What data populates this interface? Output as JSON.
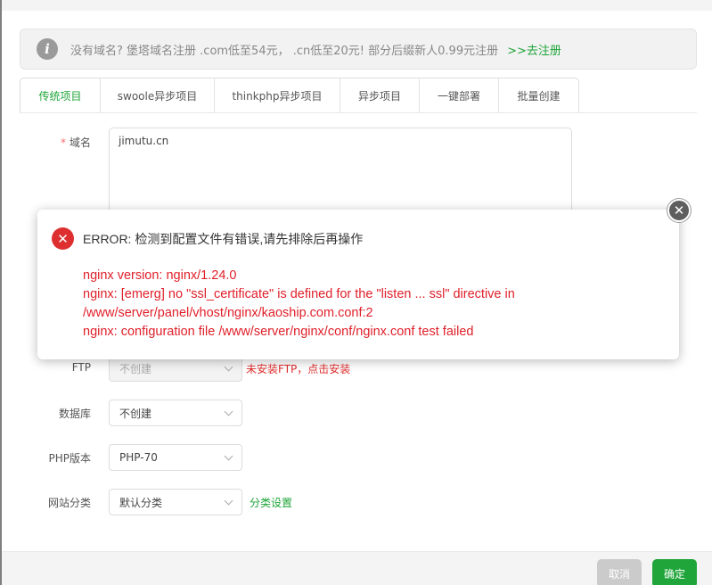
{
  "notice": {
    "icon": "info-icon",
    "text": "没有域名? 堡塔域名注册 .com低至54元， .cn低至20元! 部分后缀新人0.99元注册",
    "link": ">>去注册"
  },
  "tabs": [
    {
      "label": "传统项目"
    },
    {
      "label": "swoole异步项目"
    },
    {
      "label": "thinkphp异步项目"
    },
    {
      "label": "异步项目"
    },
    {
      "label": "一键部署"
    },
    {
      "label": "批量创建"
    }
  ],
  "form": {
    "domain": {
      "label": "域名",
      "required_mark": "*",
      "value": "jimutu.cn"
    },
    "ftp": {
      "label": "FTP",
      "value": "不创建",
      "hint": "未安装FTP，点击安装"
    },
    "database": {
      "label": "数据库",
      "value": "不创建"
    },
    "php": {
      "label": "PHP版本",
      "value": "PHP-70"
    },
    "category": {
      "label": "网站分类",
      "value": "默认分类",
      "link": "分类设置"
    }
  },
  "buttons": {
    "cancel": "取消",
    "ok": "确定"
  },
  "error_dialog": {
    "icon": "error-icon",
    "title": "ERROR: 检测到配置文件有错误,请先排除后再操作",
    "lines": [
      "nginx version: nginx/1.24.0",
      "nginx: [emerg] no \"ssl_certificate\" is defined for the \"listen ... ssl\" directive in",
      "/www/server/panel/vhost/nginx/kaoship.com.conf:2",
      "nginx: configuration file /www/server/nginx/conf/nginx.conf test failed"
    ],
    "close_icon": "close-icon"
  },
  "colors": {
    "accent": "#20a53a",
    "error": "#e0202a",
    "error_icon": "#dd2f2f"
  }
}
